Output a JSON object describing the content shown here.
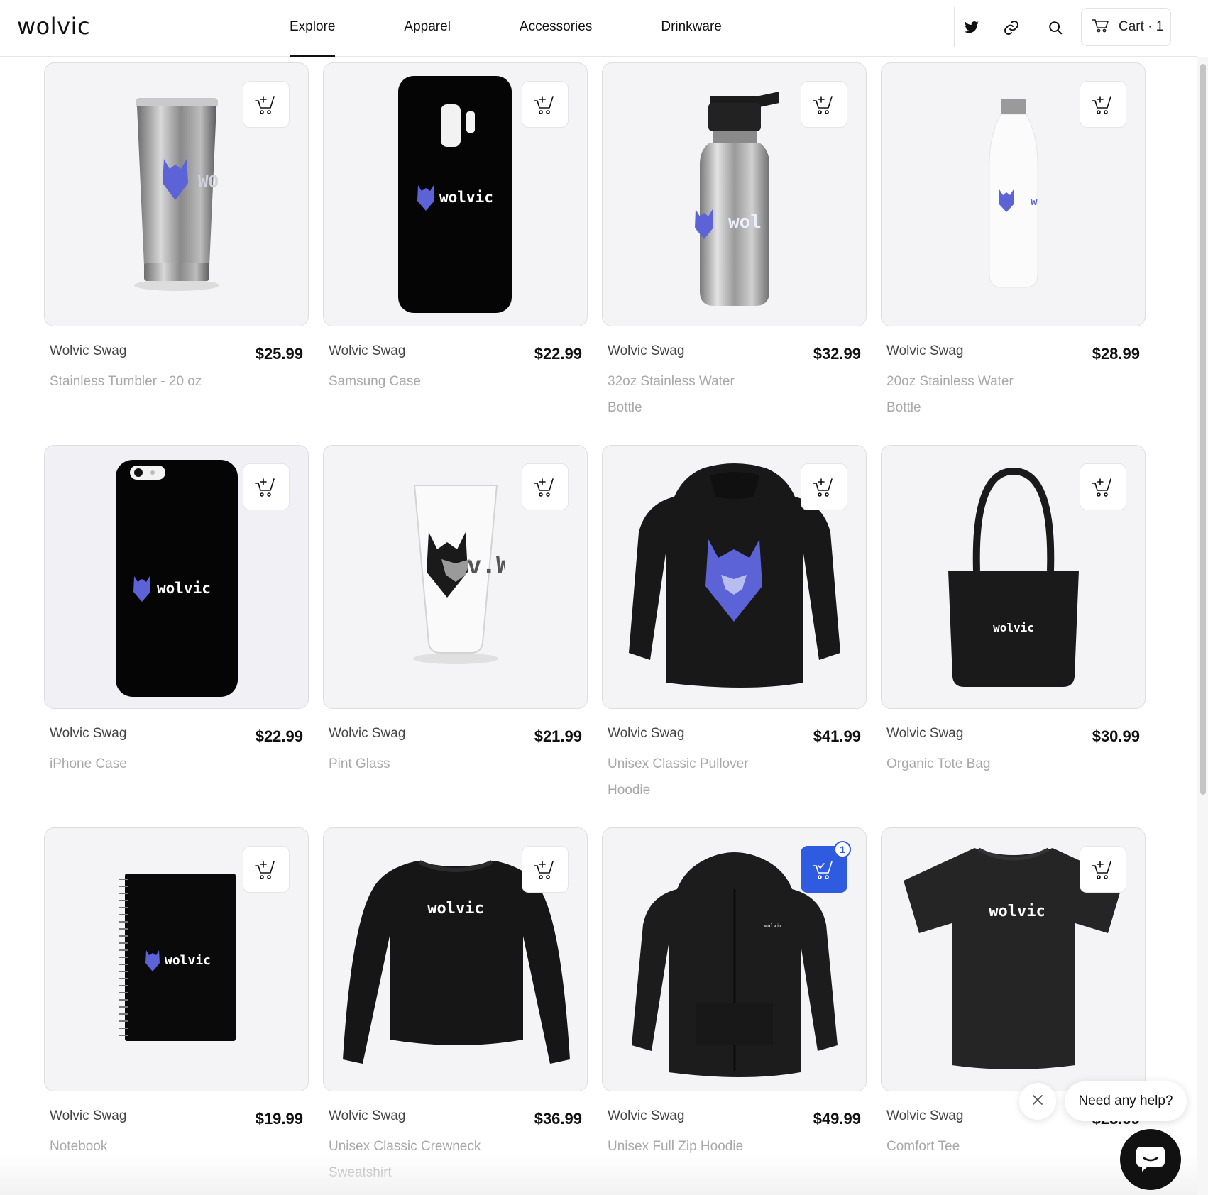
{
  "header": {
    "logo": "wolvic",
    "nav": [
      {
        "label": "Explore",
        "active": true
      },
      {
        "label": "Apparel",
        "active": false
      },
      {
        "label": "Accessories",
        "active": false
      },
      {
        "label": "Drinkware",
        "active": false
      }
    ],
    "icons": [
      "twitter-icon",
      "link-icon",
      "search-icon"
    ],
    "cart_label": "Cart · 1"
  },
  "products": [
    {
      "brand": "Wolvic Swag",
      "name": "Stainless Tumbler - 20 oz",
      "price": "$25.99",
      "in_cart": false
    },
    {
      "brand": "Wolvic Swag",
      "name": "Samsung Case",
      "price": "$22.99",
      "in_cart": false
    },
    {
      "brand": "Wolvic Swag",
      "name": "32oz Stainless Water Bottle",
      "price": "$32.99",
      "in_cart": false
    },
    {
      "brand": "Wolvic Swag",
      "name": "20oz Stainless Water Bottle",
      "price": "$28.99",
      "in_cart": false
    },
    {
      "brand": "Wolvic Swag",
      "name": "iPhone Case",
      "price": "$22.99",
      "in_cart": false
    },
    {
      "brand": "Wolvic Swag",
      "name": "Pint Glass",
      "price": "$21.99",
      "in_cart": false
    },
    {
      "brand": "Wolvic Swag",
      "name": "Unisex Classic Pullover Hoodie",
      "price": "$41.99",
      "in_cart": false
    },
    {
      "brand": "Wolvic Swag",
      "name": "Organic Tote Bag",
      "price": "$30.99",
      "in_cart": false
    },
    {
      "brand": "Wolvic Swag",
      "name": "Notebook",
      "price": "$19.99",
      "in_cart": false
    },
    {
      "brand": "Wolvic Swag",
      "name": "Unisex Classic Crewneck Sweatshirt",
      "price": "$36.99",
      "in_cart": false
    },
    {
      "brand": "Wolvic Swag",
      "name": "Unisex Full Zip Hoodie",
      "price": "$49.99",
      "in_cart": true,
      "cart_count": "1"
    },
    {
      "brand": "Wolvic Swag",
      "name": "Comfort Tee",
      "price": "$25.99",
      "in_cart": false
    }
  ],
  "product_print": "wolvic",
  "chat": {
    "prompt": "Need any help?"
  },
  "colors": {
    "accent": "#2f5be0",
    "wolf": "#5b63d6"
  }
}
